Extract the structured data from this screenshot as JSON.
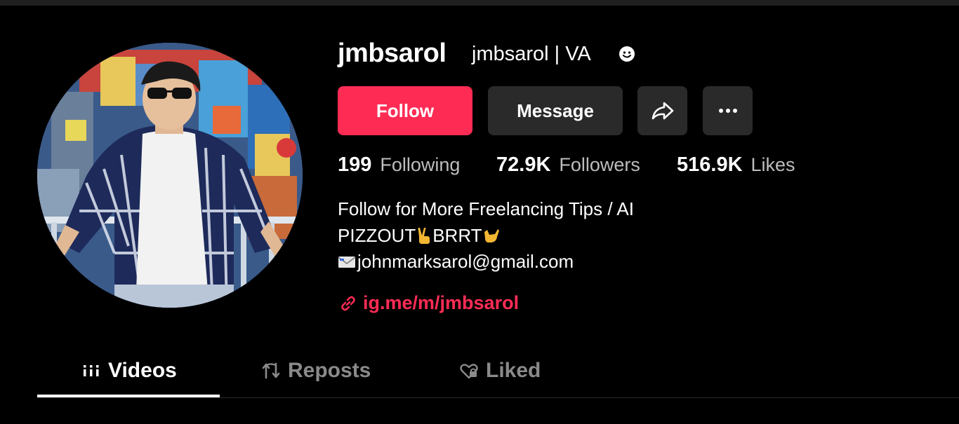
{
  "profile": {
    "username": "jmbsarol",
    "nickname": "jmbsarol | VA"
  },
  "actions": {
    "follow_label": "Follow",
    "message_label": "Message"
  },
  "stats": {
    "following": {
      "value": "199",
      "label": "Following"
    },
    "followers": {
      "value": "72.9K",
      "label": "Followers"
    },
    "likes": {
      "value": "516.9K",
      "label": "Likes"
    }
  },
  "bio": {
    "line1": "Follow for More Freelancing Tips / AI",
    "line2_a": "PIZZOUT",
    "line2_b": "BRRT",
    "line3": "johnmarksarol@gmail.com"
  },
  "link": {
    "text": "ig.me/m/jmbsarol"
  },
  "tabs": [
    {
      "label": "Videos",
      "active": true
    },
    {
      "label": "Reposts",
      "active": false
    },
    {
      "label": "Liked",
      "active": false
    }
  ],
  "colors": {
    "accent": "#fe2c55",
    "background": "#000000",
    "button_secondary": "#2a2a2a",
    "muted_text": "#bdbdbd"
  },
  "icons": {
    "verify": "smiley-badge-icon",
    "share": "share-arrow-icon",
    "more": "more-dots-icon",
    "link": "link-chain-icon",
    "mail": "envelope-icon",
    "videos": "grid-bars-icon",
    "reposts": "repost-arrows-icon",
    "liked": "heart-lock-icon"
  }
}
